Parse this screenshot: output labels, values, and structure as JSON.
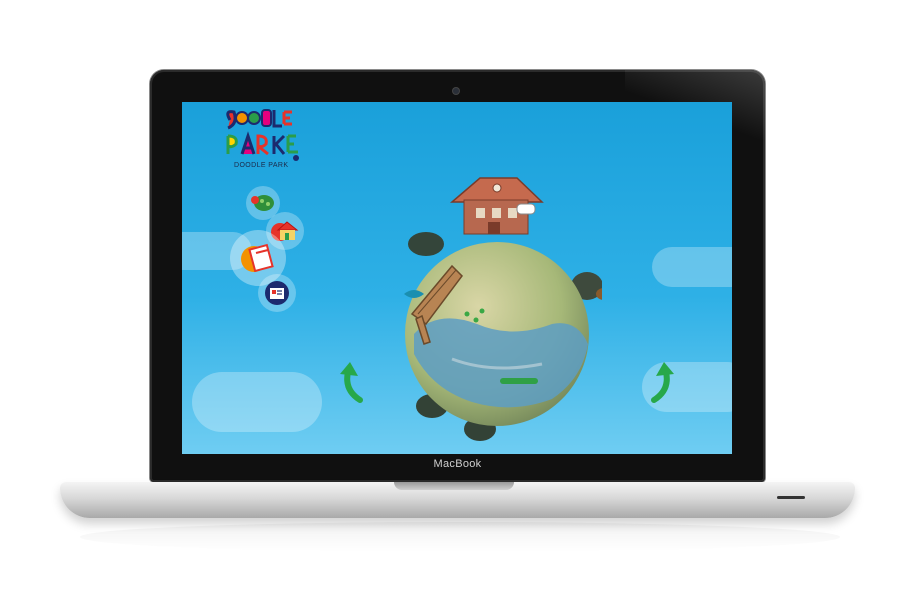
{
  "device": {
    "brand_label": "MacBook"
  },
  "app": {
    "logo_text": "DOODLE PARK"
  },
  "colors": {
    "sky_top": "#1aa0da",
    "sky_bottom": "#6fcdf2",
    "arrow_green": "#27a84a"
  },
  "nav": {
    "items": [
      {
        "icon": "tortoise-icon"
      },
      {
        "icon": "house-icon"
      },
      {
        "icon": "notebook-icon"
      },
      {
        "icon": "card-icon"
      }
    ]
  },
  "navigation_arrows": {
    "left_icon": "curved-arrow-left-icon",
    "right_icon": "curved-arrow-right-icon"
  }
}
